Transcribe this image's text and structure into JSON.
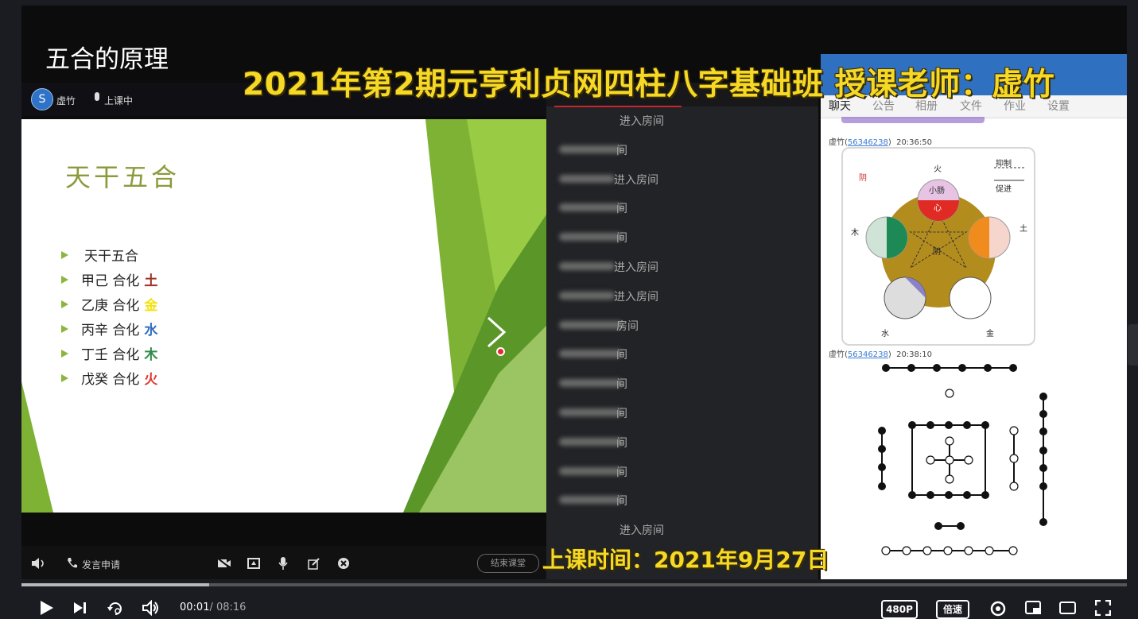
{
  "video": {
    "title": "五合的原理",
    "banner": "2021年第2期元亨利贞网四柱八字基础班 授课老师：虚竹",
    "date_banner": "上课时间：2021年9月27日"
  },
  "app": {
    "teacher": "虚竹",
    "status": "上课中",
    "avatar_letter": "S",
    "apply_label": "发言申请",
    "end_label": "结束课堂"
  },
  "slide": {
    "title": "天干五合",
    "bullets": [
      {
        "text": "天干五合",
        "element": "",
        "color": ""
      },
      {
        "text": "甲己 合化",
        "element": "土",
        "color": "#a0332a"
      },
      {
        "text": "乙庚 合化",
        "element": "金",
        "color": "#f3e20f"
      },
      {
        "text": "丙辛 合化",
        "element": "水",
        "color": "#2f6fc0"
      },
      {
        "text": "丁壬 合化",
        "element": "木",
        "color": "#2e8a48"
      },
      {
        "text": "戊癸 合化",
        "element": "火",
        "color": "#e13a2f"
      }
    ]
  },
  "rooms": {
    "first": "进入房间",
    "items": [
      "间",
      "进入房间",
      "间",
      "间",
      "进入房间",
      "进入房间",
      "房间",
      "间",
      "间",
      "间",
      "间",
      "间",
      "间"
    ],
    "last": "进入房间"
  },
  "chat": {
    "tabs": [
      "聊天",
      "公告",
      "相册",
      "文件",
      "作业",
      "设置"
    ],
    "messages": [
      {
        "user": "虚竹",
        "id": "56346238",
        "time": "20:36:50"
      },
      {
        "user": "虚竹",
        "id": "56346238",
        "time": "20:38:10"
      }
    ],
    "diagram": {
      "legend_top": "抑制",
      "legend_bottom": "促进",
      "yin_label": "阴",
      "center_label": "阴",
      "top_circle_label": "小肠",
      "top_inner_label": "心",
      "elements": [
        "火",
        "土",
        "金",
        "水",
        "木"
      ]
    }
  },
  "player": {
    "time_current": "00:01",
    "time_total": "/ 08:16",
    "progress": 0.17,
    "quality": "480P",
    "speed": "倍速"
  }
}
